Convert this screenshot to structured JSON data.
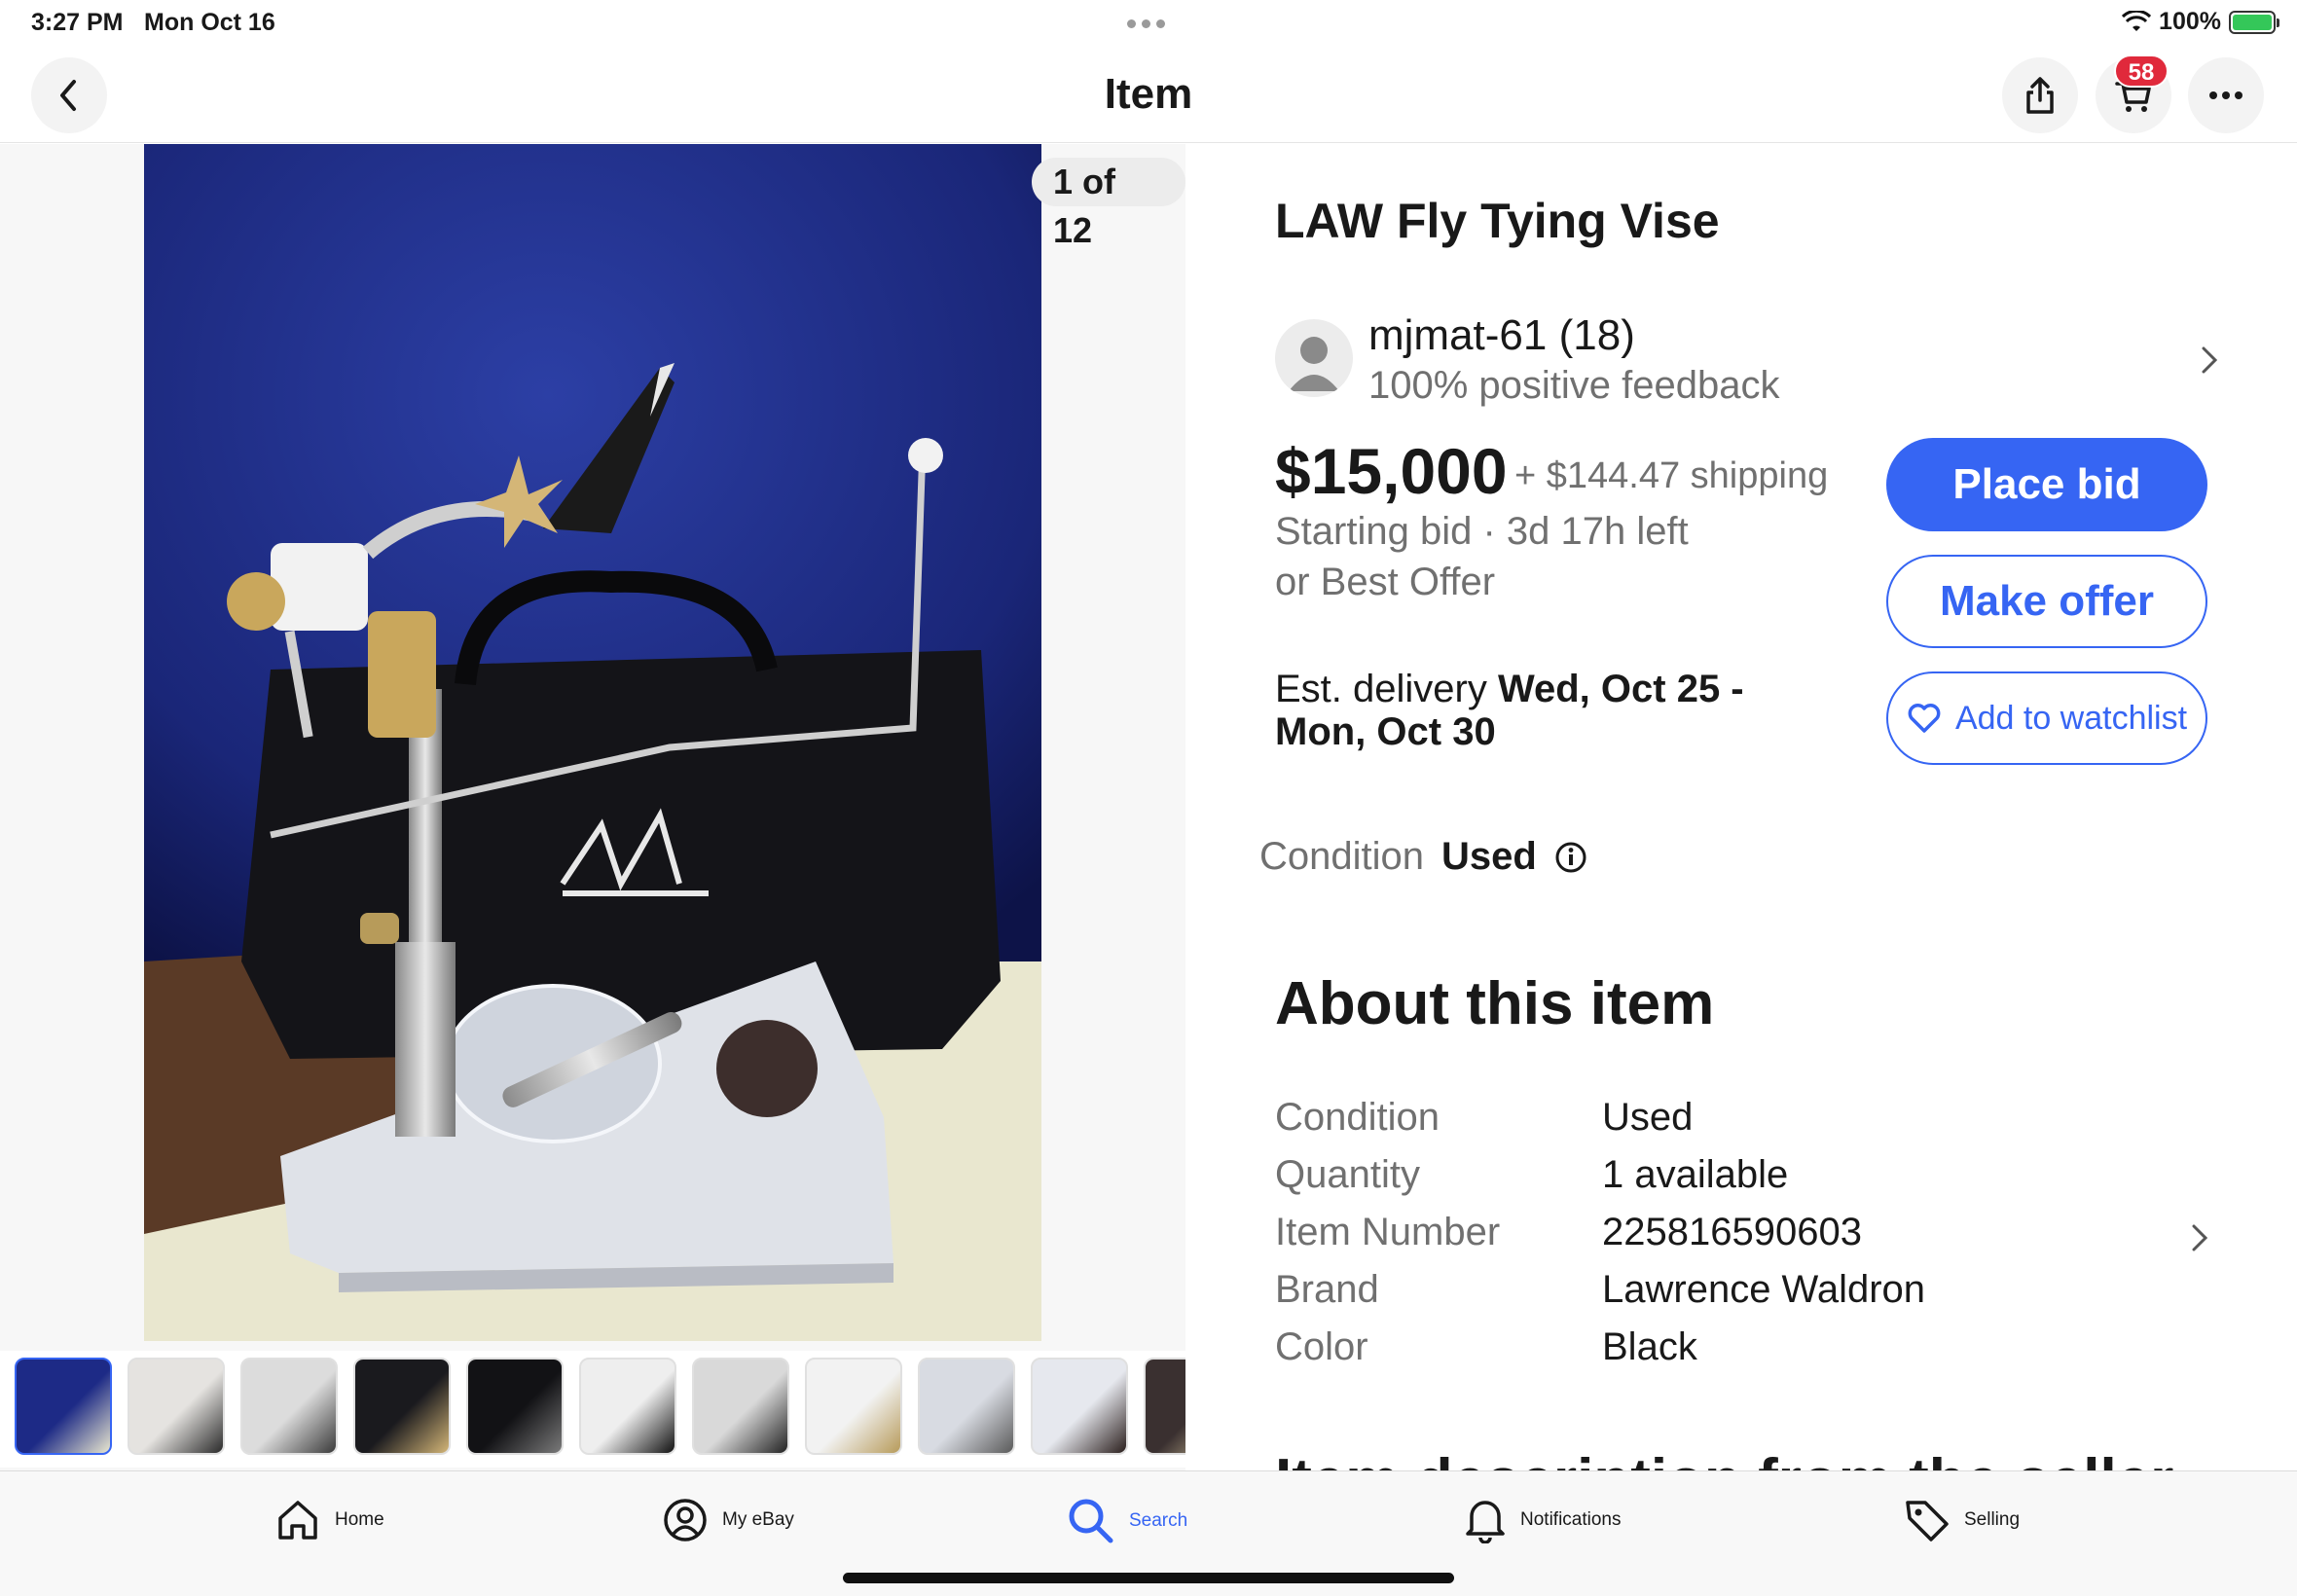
{
  "status_bar": {
    "time": "3:27 PM",
    "date": "Mon Oct 16",
    "battery": "100%"
  },
  "nav": {
    "title": "Item",
    "cart_count": "58"
  },
  "media": {
    "counter": "1 of 12",
    "thumbnail_count": 12
  },
  "item": {
    "title": "LAW Fly Tying Vise",
    "seller": {
      "name": "mjmat-61 (18)",
      "feedback": "100% positive feedback"
    },
    "price": "$15,000",
    "shipping": "+ $144.47 shipping",
    "bid_info": "Starting bid · 3d 17h left",
    "best_offer": "or Best Offer",
    "delivery_prefix": "Est. delivery ",
    "delivery_dates": "Wed, Oct 25 - Mon, Oct 30",
    "condition_label": "Condition",
    "condition_value": "Used"
  },
  "actions": {
    "place_bid": "Place bid",
    "make_offer": "Make offer",
    "watchlist": "Add to watchlist"
  },
  "about": {
    "heading": "About this item",
    "specs": [
      {
        "label": "Condition",
        "value": "Used"
      },
      {
        "label": "Quantity",
        "value": "1 available"
      },
      {
        "label": "Item Number",
        "value": "225816590603"
      },
      {
        "label": "Brand",
        "value": "Lawrence Waldron"
      },
      {
        "label": "Color",
        "value": "Black"
      }
    ],
    "next_heading": "Item description from the seller"
  },
  "tabs": [
    {
      "label": "Home",
      "icon": "home-icon"
    },
    {
      "label": "My eBay",
      "icon": "user-circle-icon"
    },
    {
      "label": "Search",
      "icon": "search-icon"
    },
    {
      "label": "Notifications",
      "icon": "bell-icon"
    },
    {
      "label": "Selling",
      "icon": "tag-icon"
    }
  ],
  "colors": {
    "accent": "#3665f3",
    "badge": "#e0293b",
    "text_secondary": "#707070"
  }
}
